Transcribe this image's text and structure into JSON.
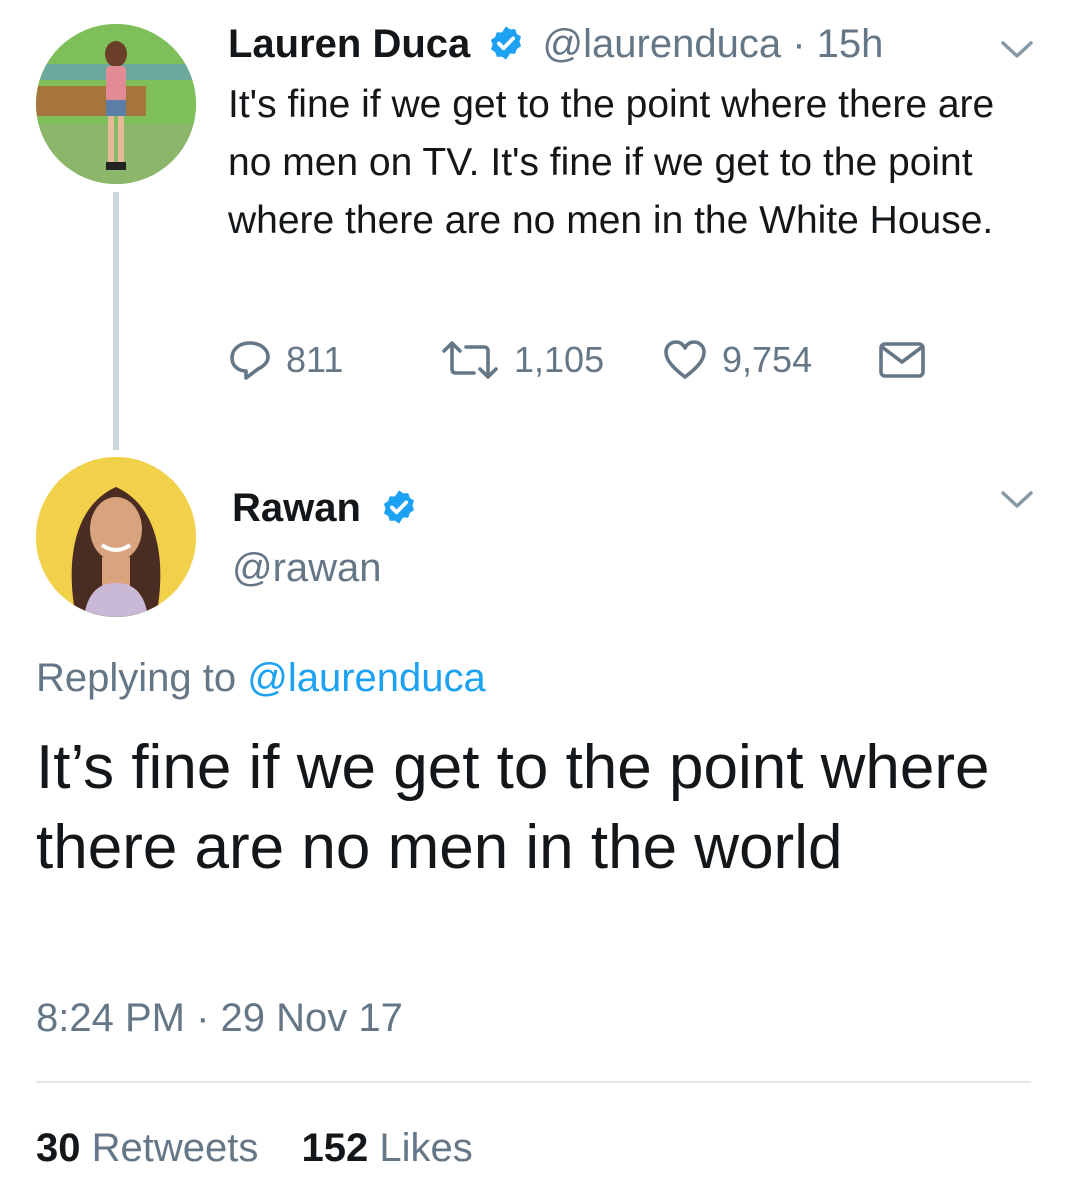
{
  "thread": {
    "original_tweet": {
      "author_name": "Lauren Duca",
      "handle": "@laurenduca",
      "separator": "·",
      "time_ago": "15h",
      "text": "It's fine if we get to the point where there are no men on TV. It's fine if we get to the point where there are no men in the White House.",
      "replies_count": "811",
      "retweets_count": "1,105",
      "likes_count": "9,754",
      "icons": [
        "reply-icon",
        "retweet-icon",
        "heart-icon",
        "direct-message-icon",
        "chevron-down-icon",
        "verified-badge-icon"
      ]
    },
    "reply_tweet": {
      "author_name": "Rawan",
      "handle": "@rawan",
      "replying_prefix": "Replying to",
      "replying_to": "@laurenduca",
      "text": "It’s fine if we get to the point where there are no men in the world",
      "time": "8:24 PM",
      "separator": "·",
      "date": "29 Nov 17",
      "retweets_count": "30",
      "retweets_label": "Retweets",
      "likes_count": "152",
      "likes_label": "Likes"
    }
  },
  "colors": {
    "text": "#14171a",
    "muted": "#657786",
    "accent": "#1da1f2",
    "thread_line": "#cbd6dd",
    "divider": "#e1e8ed"
  }
}
